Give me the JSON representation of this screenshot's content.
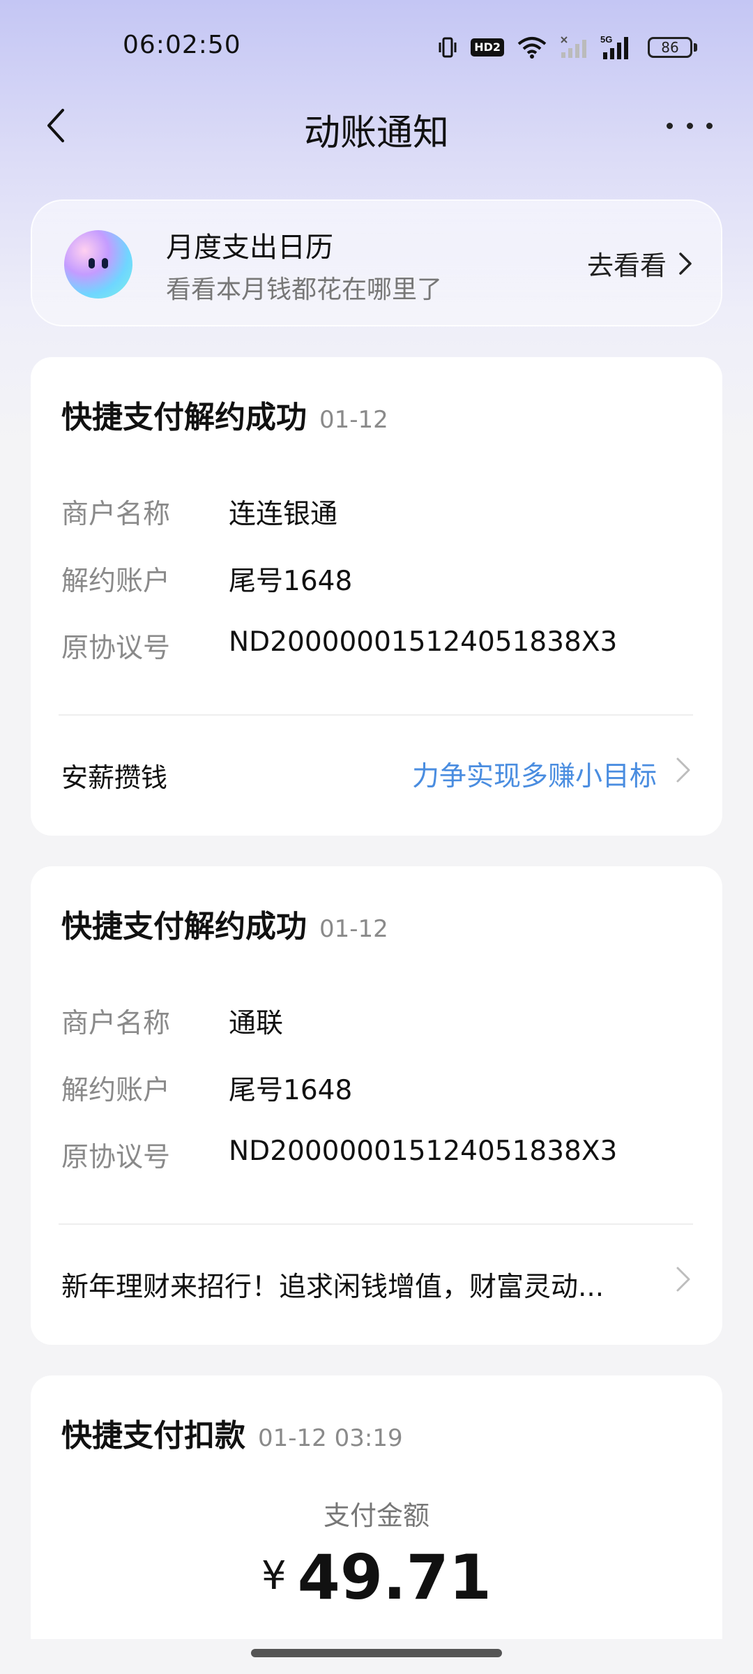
{
  "status_bar": {
    "time": "06:02:50",
    "network": "5G",
    "hd": "HD2",
    "battery": "86"
  },
  "header": {
    "title": "动账通知"
  },
  "banner": {
    "title": "月度支出日历",
    "subtitle": "看看本月钱都花在哪里了",
    "action": "去看看"
  },
  "cards": [
    {
      "title": "快捷支付解约成功",
      "date": "01-12",
      "rows": [
        {
          "label": "商户名称",
          "value": "连连银通"
        },
        {
          "label": "解约账户",
          "value": "尾号1648"
        },
        {
          "label": "原协议号",
          "value": "ND200000015124051838X3"
        }
      ],
      "footer_left": "安薪攒钱",
      "footer_right": "力争实现多赚小目标"
    },
    {
      "title": "快捷支付解约成功",
      "date": "01-12",
      "rows": [
        {
          "label": "商户名称",
          "value": "通联"
        },
        {
          "label": "解约账户",
          "value": "尾号1648"
        },
        {
          "label": "原协议号",
          "value": "ND200000015124051838X3"
        }
      ],
      "footer_text": "新年理财来招行！追求闲钱增值，财富灵动..."
    },
    {
      "title": "快捷支付扣款",
      "date": "01-12 03:19",
      "amount_label": "支付金额",
      "currency": "¥",
      "amount": "49.71"
    }
  ],
  "colors": {
    "accent_link": "#4a8de0",
    "label_gray": "#8a8a8a"
  }
}
